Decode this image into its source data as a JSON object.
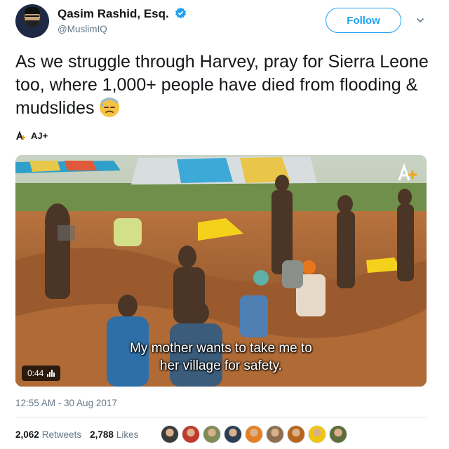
{
  "tweet": {
    "display_name": "Qasim Rashid, Esq.",
    "handle": "@MuslimIQ",
    "follow_label": "Follow",
    "text": "As we struggle through Harvey, pray for Sierra Leone too, where 1,000+ people have died from flooding & mudslides",
    "emoji": "downcast-face-with-sweat",
    "source_label": "AJ+",
    "timestamp": "12:55 AM - 30 Aug 2017",
    "retweets_count": "2,062",
    "retweets_label": "Retweets",
    "likes_count": "2,788",
    "likes_label": "Likes"
  },
  "video": {
    "caption_line1": "My mother wants to take me to",
    "caption_line2": "her village for safety.",
    "duration": "0:44",
    "logo": "aj-plus-logo"
  },
  "likers": [
    {
      "color": "#3a3a3a"
    },
    {
      "color": "#c0392b"
    },
    {
      "color": "#7f8c5a"
    },
    {
      "color": "#2c3e50"
    },
    {
      "color": "#e67e22"
    },
    {
      "color": "#8e6e53"
    },
    {
      "color": "#b5651d"
    },
    {
      "color": "#f1c40f"
    },
    {
      "color": "#5d6d3a"
    }
  ],
  "colors": {
    "brand_blue": "#1da1f2",
    "secondary_text": "#657786",
    "primary_text": "#14171a",
    "divider": "#e1e8ed"
  }
}
